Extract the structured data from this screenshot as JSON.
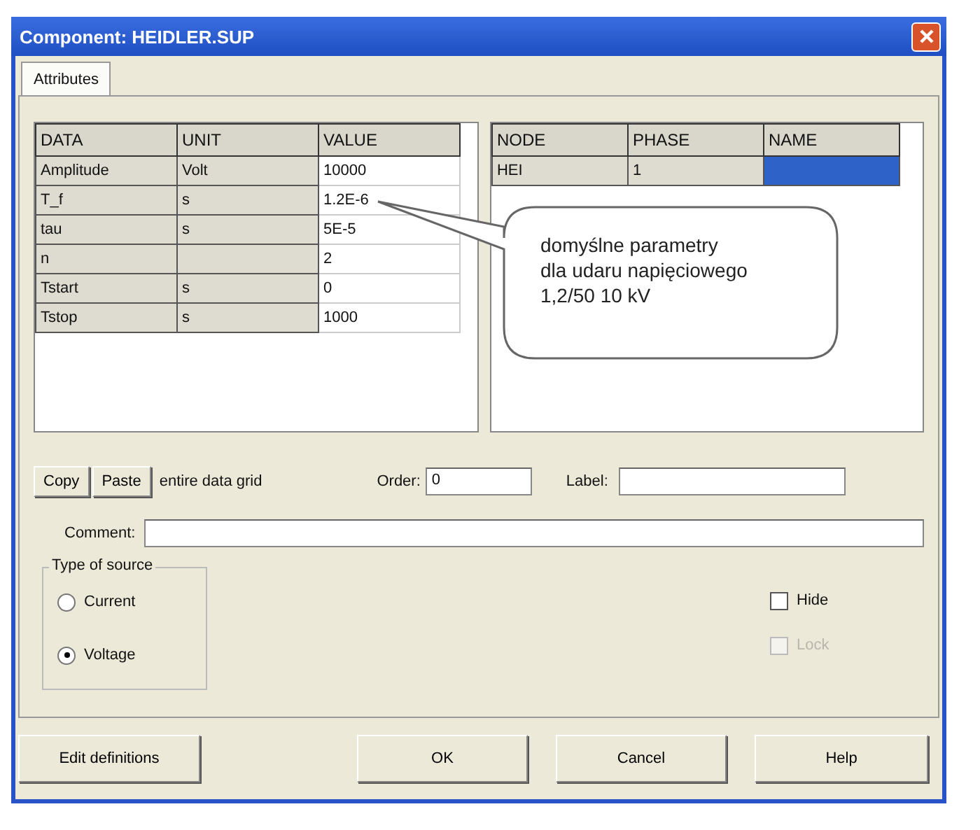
{
  "window": {
    "title": "Component: HEIDLER.SUP"
  },
  "tabs": [
    {
      "label": "Attributes",
      "selected": true
    }
  ],
  "data_grid": {
    "columns": [
      "DATA",
      "UNIT",
      "VALUE"
    ],
    "rows": [
      {
        "data": "Amplitude",
        "unit": "Volt",
        "value": "10000"
      },
      {
        "data": "T_f",
        "unit": "s",
        "value": "1.2E-6"
      },
      {
        "data": "tau",
        "unit": "s",
        "value": "5E-5"
      },
      {
        "data": "n",
        "value": "2"
      },
      {
        "data": "Tstart",
        "unit": "s",
        "value": "0"
      },
      {
        "data": "Tstop",
        "unit": "s",
        "value": "1000"
      }
    ]
  },
  "node_grid": {
    "columns": [
      "NODE",
      "PHASE",
      "NAME"
    ],
    "rows": [
      {
        "node": "HEI",
        "phase": "1",
        "name_selected": true
      }
    ]
  },
  "callout": {
    "text": "domyślne parametry\ndla udaru napięciowego\n1,2/50 10 kV"
  },
  "grid_buttons": [
    "Copy",
    "Paste"
  ],
  "grid_note": "entire data grid",
  "order": {
    "label": "Order:",
    "value": "0"
  },
  "label_field": {
    "label": "Label:"
  },
  "comment": {
    "label": "Comment:"
  },
  "source_type": {
    "title": "Type of source",
    "options": [
      {
        "label": "Current",
        "selected": false
      },
      {
        "label": "Voltage",
        "selected": true
      }
    ]
  },
  "checkboxes": [
    {
      "label": "Hide",
      "checked": false,
      "disabled": false
    },
    {
      "label": "Lock",
      "checked": false,
      "disabled": true
    }
  ],
  "buttons": [
    "Edit definitions",
    "OK",
    "Cancel",
    "Help"
  ]
}
